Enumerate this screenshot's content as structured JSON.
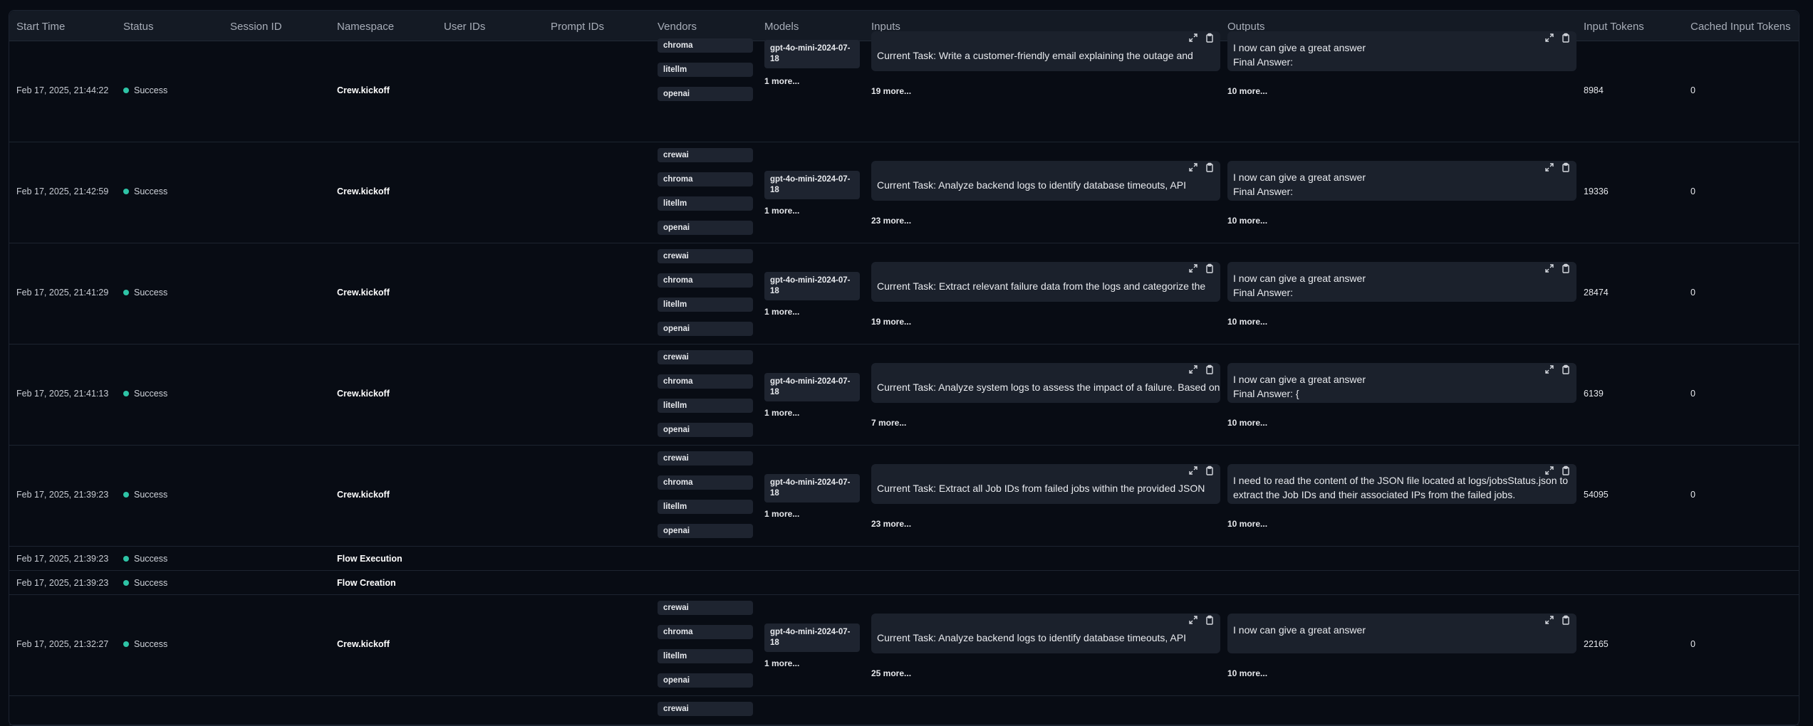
{
  "headers": {
    "start_time": "Start Time",
    "status": "Status",
    "session_id": "Session ID",
    "namespace": "Namespace",
    "user_ids": "User IDs",
    "prompt_ids": "Prompt IDs",
    "vendors": "Vendors",
    "models": "Models",
    "inputs": "Inputs",
    "outputs": "Outputs",
    "input_tokens": "Input Tokens",
    "cached_input_tokens": "Cached Input Tokens"
  },
  "rows": [
    {
      "start_time": "Feb 17, 2025, 21:44:22",
      "status": "Success",
      "namespace": "Crew.kickoff",
      "vendors": [
        "chroma",
        "litellm",
        "openai"
      ],
      "model": "gpt-4o-mini-2024-07-18",
      "models_more": "1 more...",
      "input": "Current Task: Write a customer-friendly email explaining the outage and",
      "inputs_more": "19 more...",
      "output_line1": "I now can give a great answer",
      "output_line2": "Final Answer:",
      "outputs_more": "10 more...",
      "input_tokens": "8984",
      "cached_input_tokens": "0",
      "extra": "",
      "kind": "crew"
    },
    {
      "start_time": "Feb 17, 2025, 21:42:59",
      "status": "Success",
      "namespace": "Crew.kickoff",
      "vendors": [
        "crewai",
        "chroma",
        "litellm",
        "openai"
      ],
      "model": "gpt-4o-mini-2024-07-18",
      "models_more": "1 more...",
      "input": "Current Task: Analyze backend logs to identify database timeouts, API",
      "inputs_more": "23 more...",
      "output_line1": "I now can give a great answer",
      "output_line2": "Final Answer:",
      "outputs_more": "10 more...",
      "input_tokens": "19336",
      "cached_input_tokens": "0",
      "extra": "",
      "kind": "crew"
    },
    {
      "start_time": "Feb 17, 2025, 21:41:29",
      "status": "Success",
      "namespace": "Crew.kickoff",
      "vendors": [
        "crewai",
        "chroma",
        "litellm",
        "openai"
      ],
      "model": "gpt-4o-mini-2024-07-18",
      "models_more": "1 more...",
      "input": "Current Task: Extract relevant failure data from the logs and categorize the",
      "inputs_more": "19 more...",
      "output_line1": "I now can give a great answer",
      "output_line2": "Final Answer:",
      "outputs_more": "10 more...",
      "input_tokens": "28474",
      "cached_input_tokens": "0",
      "extra": "",
      "kind": "crew"
    },
    {
      "start_time": "Feb 17, 2025, 21:41:13",
      "status": "Success",
      "namespace": "Crew.kickoff",
      "vendors": [
        "crewai",
        "chroma",
        "litellm",
        "openai"
      ],
      "model": "gpt-4o-mini-2024-07-18",
      "models_more": "1 more...",
      "input": "Current Task: Analyze system logs to assess the impact of a failure. Based on",
      "inputs_more": "7 more...",
      "output_line1": "I now can give a great answer",
      "output_line2": "Final Answer: {",
      "outputs_more": "10 more...",
      "input_tokens": "6139",
      "cached_input_tokens": "0",
      "extra": "",
      "kind": "crew"
    },
    {
      "start_time": "Feb 17, 2025, 21:39:23",
      "status": "Success",
      "namespace": "Crew.kickoff",
      "vendors": [
        "crewai",
        "chroma",
        "litellm",
        "openai"
      ],
      "model": "gpt-4o-mini-2024-07-18",
      "models_more": "1 more...",
      "input": "Current Task: Extract all Job IDs from failed jobs within the provided JSON",
      "inputs_more": "23 more...",
      "output_line1": "I need to read the content of the JSON file located at logs/jobsStatus.json to",
      "output_line2": "extract the Job IDs and their associated IPs from the failed jobs.",
      "outputs_more": "10 more...",
      "input_tokens": "54095",
      "cached_input_tokens": "0",
      "extra": "",
      "kind": "crew"
    },
    {
      "start_time": "Feb 17, 2025, 21:39:23",
      "status": "Success",
      "namespace": "Flow Execution",
      "kind": "flow"
    },
    {
      "start_time": "Feb 17, 2025, 21:39:23",
      "status": "Success",
      "namespace": "Flow Creation",
      "kind": "flow"
    },
    {
      "start_time": "Feb 17, 2025, 21:32:27",
      "status": "Success",
      "namespace": "Crew.kickoff",
      "vendors": [
        "crewai",
        "chroma",
        "litellm",
        "openai"
      ],
      "model": "gpt-4o-mini-2024-07-18",
      "models_more": "1 more...",
      "input": "Current Task: Analyze backend logs to identify database timeouts, API",
      "inputs_more": "25 more...",
      "output_line1": "I now can give a great answer",
      "output_line2": "",
      "outputs_more": "10 more...",
      "input_tokens": "22165",
      "cached_input_tokens": "0",
      "extra": "",
      "kind": "crew"
    },
    {
      "start_time": "",
      "status": "",
      "namespace": "",
      "vendors": [
        "crewai"
      ],
      "kind": "partial"
    }
  ]
}
